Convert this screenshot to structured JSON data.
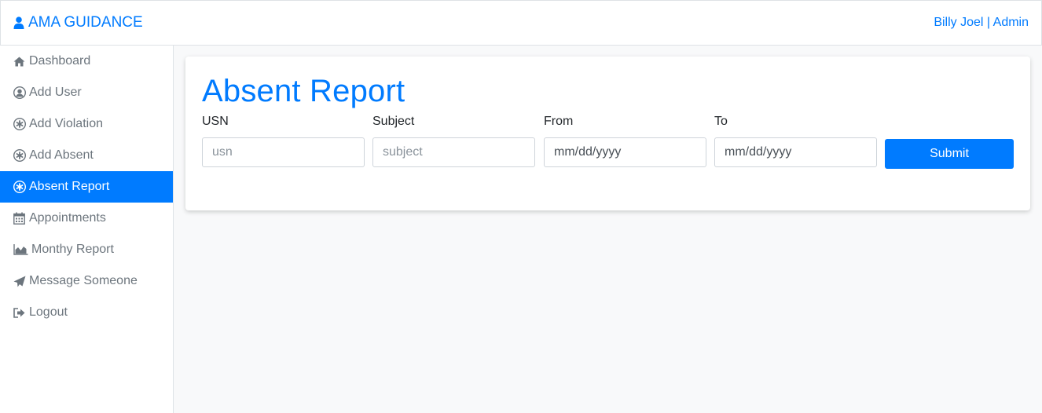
{
  "navbar": {
    "brand": "AMA GUIDANCE",
    "user_name": "Billy Joel",
    "separator": " | ",
    "role": "Admin"
  },
  "sidebar": {
    "items": [
      {
        "label": "Dashboard",
        "icon": "home-icon"
      },
      {
        "label": "Add User",
        "icon": "user-circle-icon"
      },
      {
        "label": "Add Violation",
        "icon": "asterisk-circle-icon"
      },
      {
        "label": "Add Absent",
        "icon": "asterisk-circle-icon"
      },
      {
        "label": "Absent Report",
        "icon": "asterisk-circle-icon",
        "active": true
      },
      {
        "label": "Appointments",
        "icon": "calendar-icon"
      },
      {
        "label": "Monthy Report",
        "icon": "area-chart-icon"
      },
      {
        "label": "Message Someone",
        "icon": "paper-plane-icon"
      },
      {
        "label": "Logout",
        "icon": "sign-out-icon"
      }
    ]
  },
  "report": {
    "title": "Absent Report",
    "usn_label": "USN",
    "usn_placeholder": "usn",
    "subject_label": "Subject",
    "subject_placeholder": "subject",
    "from_label": "From",
    "from_value": "mm/dd/yyyy",
    "to_label": "To",
    "to_value": "mm/dd/yyyy",
    "submit_label": "Submit"
  },
  "colors": {
    "primary": "#007bff",
    "muted": "#6c757d",
    "background": "#f8f9fa"
  }
}
